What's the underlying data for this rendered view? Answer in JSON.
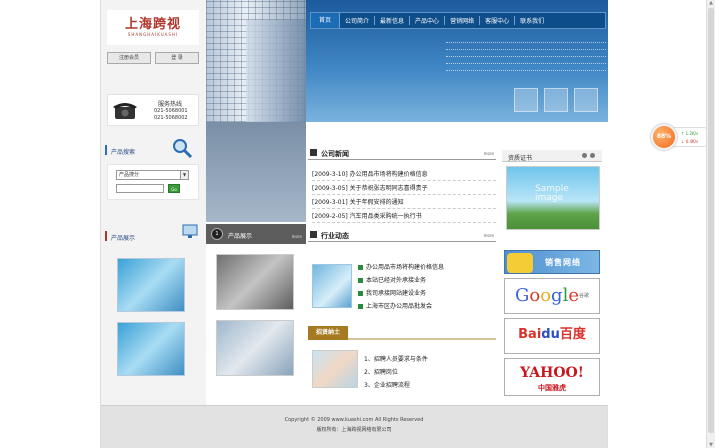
{
  "logo": {
    "cn": "上海跨视",
    "en": "SHANGHAIKUASHI"
  },
  "left": {
    "buttons": [
      "注册会员",
      "登 录"
    ],
    "hotline": {
      "label": "服务热线",
      "phones": [
        "021-5068001",
        "021-5068002"
      ]
    },
    "product_search": {
      "title": "产品搜索",
      "select_value": "产品搜分",
      "go_label": "Go"
    },
    "product_show": {
      "title": "产品展示"
    }
  },
  "nav": [
    "首页",
    "公司简介",
    "最新信息",
    "产品中心",
    "营销网络",
    "客服中心",
    "联系我们"
  ],
  "company_news": {
    "title": "公司新闻",
    "more": "more",
    "items": [
      "[2009-3-10] 办公用品市场将构建价格信息",
      "[2009-3-05] 关于恭祝张志明同志喜得贵子",
      "[2009-3-01] 关于年假安排的通知",
      "[2009-2-05] 汽车用品类采购统一执行书"
    ]
  },
  "industry_news": {
    "title": "行业动态",
    "more": "more",
    "items": [
      "办公用品市场将构建价格信息",
      "本站已经对外承接业务",
      "我司承接网站建设业务",
      "上海市区办公用品批发会"
    ]
  },
  "job": {
    "title": "招贤纳士",
    "items": [
      "1、招聘人员要求与条件",
      "2、招聘岗位",
      "3、企业招聘流程"
    ]
  },
  "product_display": {
    "title": "产品展示",
    "more": "more"
  },
  "qualification": {
    "title": "资质证书"
  },
  "sample_text": [
    "Sample",
    "image"
  ],
  "sales_network": {
    "label": "销售网络"
  },
  "links": {
    "google_letters": [
      "G",
      "o",
      "o",
      "g",
      "l",
      "e"
    ],
    "google_cn": "谷歌",
    "baidu_a": "Bai",
    "baidu_b": "du",
    "baidu_cn": "百度",
    "yahoo": "YAHOO!",
    "yahoo_cn": "中国雅虎"
  },
  "footer": {
    "copyright": "Copyright © 2009 www.kuashi.com All Rights Reserved",
    "line2": "版权所有：上海跨视网络有限公司"
  },
  "widget": {
    "percent": "88%",
    "up": "1.2K/s",
    "down": "0.4K/s"
  },
  "colors": {
    "accent": "#1b6cb5",
    "job_tag": "#a57a20",
    "widget": "#ef6a1e"
  }
}
